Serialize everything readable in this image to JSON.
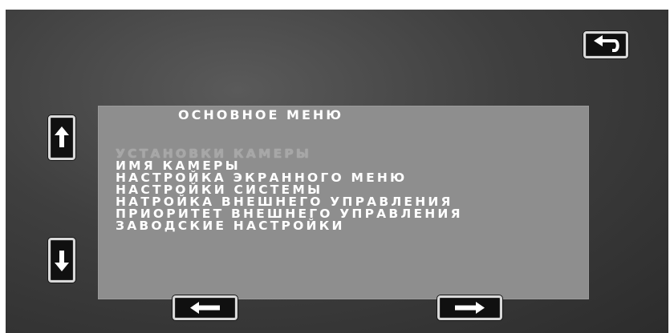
{
  "menu": {
    "title": "ОСНОВНОЕ МЕНЮ",
    "items": [
      {
        "label": "УСТАНОВКИ КАМЕРЫ",
        "selected": true
      },
      {
        "label": "ИМЯ КАМЕРЫ",
        "selected": false
      },
      {
        "label": "НАСТРОЙКА ЭКРАННОГО МЕНЮ",
        "selected": false
      },
      {
        "label": "НАСТРОЙКИ СИСТЕМЫ",
        "selected": false
      },
      {
        "label": "НАТРОЙКА ВНЕШНЕГО УПРАВЛЕНИЯ",
        "selected": false
      },
      {
        "label": "ПРИОРИТЕТ ВНЕШНЕГО УПРАВЛЕНИЯ",
        "selected": false
      },
      {
        "label": "ЗАВОДСКИЕ НАСТРОЙКИ",
        "selected": false
      }
    ]
  },
  "buttons": {
    "back": "return-arrow-icon",
    "up": "arrow-up-icon",
    "down": "arrow-down-icon",
    "left": "arrow-left-icon",
    "right": "arrow-right-icon"
  },
  "colors": {
    "screen_background": "#3f3f3f",
    "menu_panel": "#8e8e8e",
    "menu_text": "#ffffff",
    "selected_text": "#a7a7a7",
    "button_fill": "#101010",
    "button_border": "#d9d9d9"
  }
}
